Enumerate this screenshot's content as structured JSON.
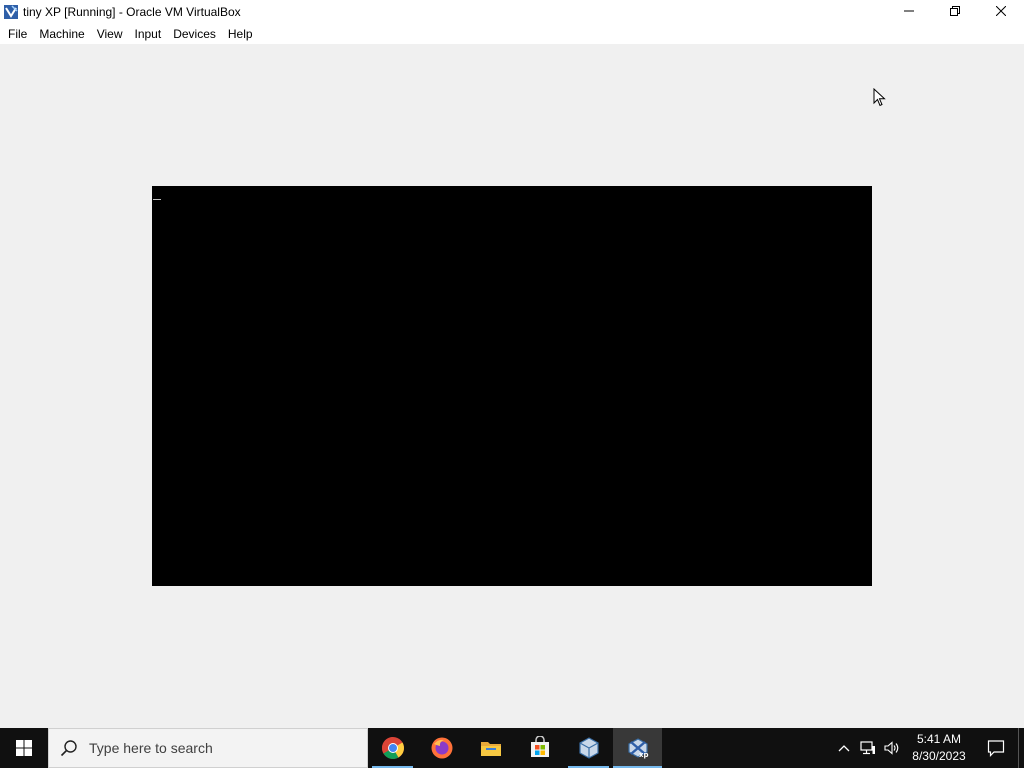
{
  "window": {
    "title": "tiny XP [Running] - Oracle VM VirtualBox"
  },
  "menu": {
    "items": [
      "File",
      "Machine",
      "View",
      "Input",
      "Devices",
      "Help"
    ]
  },
  "taskbar": {
    "search_placeholder": "Type here to search",
    "apps": [
      {
        "icon": "chrome-icon",
        "running": true
      },
      {
        "icon": "firefox-icon",
        "running": false
      },
      {
        "icon": "file-explorer-icon",
        "running": false
      },
      {
        "icon": "microsoft-store-icon",
        "running": false
      },
      {
        "icon": "virtualbox-manager-icon",
        "running": true
      },
      {
        "icon": "virtualbox-vm-icon",
        "running": true,
        "active": true
      }
    ],
    "clock": {
      "time": "5:41 AM",
      "date": "8/30/2023"
    }
  },
  "colors": {
    "taskbar_bg": "#101010",
    "vm_screen": "#000000",
    "accent": "#76b9ed"
  }
}
